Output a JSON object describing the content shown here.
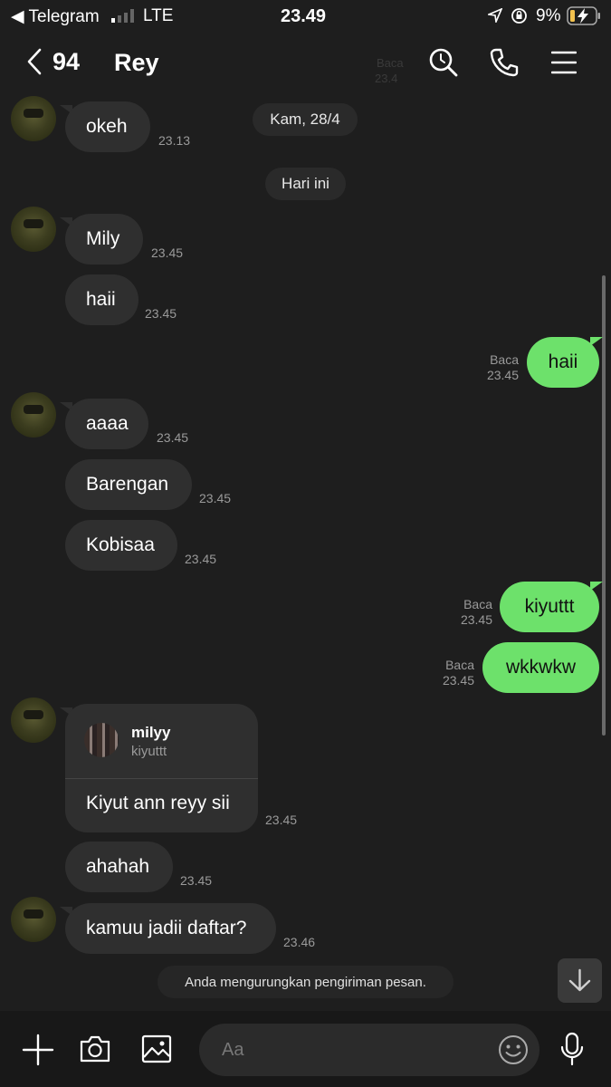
{
  "status_bar": {
    "back_app": "◀ Telegram",
    "network": "LTE",
    "time": "23.49",
    "battery": "9%"
  },
  "header": {
    "back_count": "94",
    "contact_name": "Rey",
    "faded_read": "Baca",
    "faded_time": "23.4"
  },
  "dates": {
    "first": "Kam, 28/4",
    "today": "Hari ini"
  },
  "messages": [
    {
      "text": "okeh",
      "time": "23.13"
    },
    {
      "text": "Mily",
      "time": "23.45"
    },
    {
      "text": "haii",
      "time": "23.45"
    },
    {
      "text": "haii",
      "time": "23.45",
      "read": "Baca"
    },
    {
      "text": "aaaa",
      "time": "23.45"
    },
    {
      "text": "Barengan",
      "time": "23.45"
    },
    {
      "text": "Kobisaa",
      "time": "23.45"
    },
    {
      "text": "kiyuttt",
      "time": "23.45",
      "read": "Baca"
    },
    {
      "text": "wkkwkw",
      "time": "23.45",
      "read": "Baca"
    },
    {
      "text": "Kiyut ann reyy sii",
      "time": "23.45",
      "reply_name": "milyy",
      "reply_text": "kiyuttt"
    },
    {
      "text": "ahahah",
      "time": "23.45"
    },
    {
      "text": "kamuu jadii daftar?",
      "time": "23.46"
    }
  ],
  "notice": "Anda mengurungkan pengiriman pesan.",
  "input": {
    "placeholder": "Aa"
  },
  "colors": {
    "outgoing_bubble": "#6de16b",
    "incoming_bubble": "#2f2f2f",
    "background": "#1e1e1e"
  }
}
